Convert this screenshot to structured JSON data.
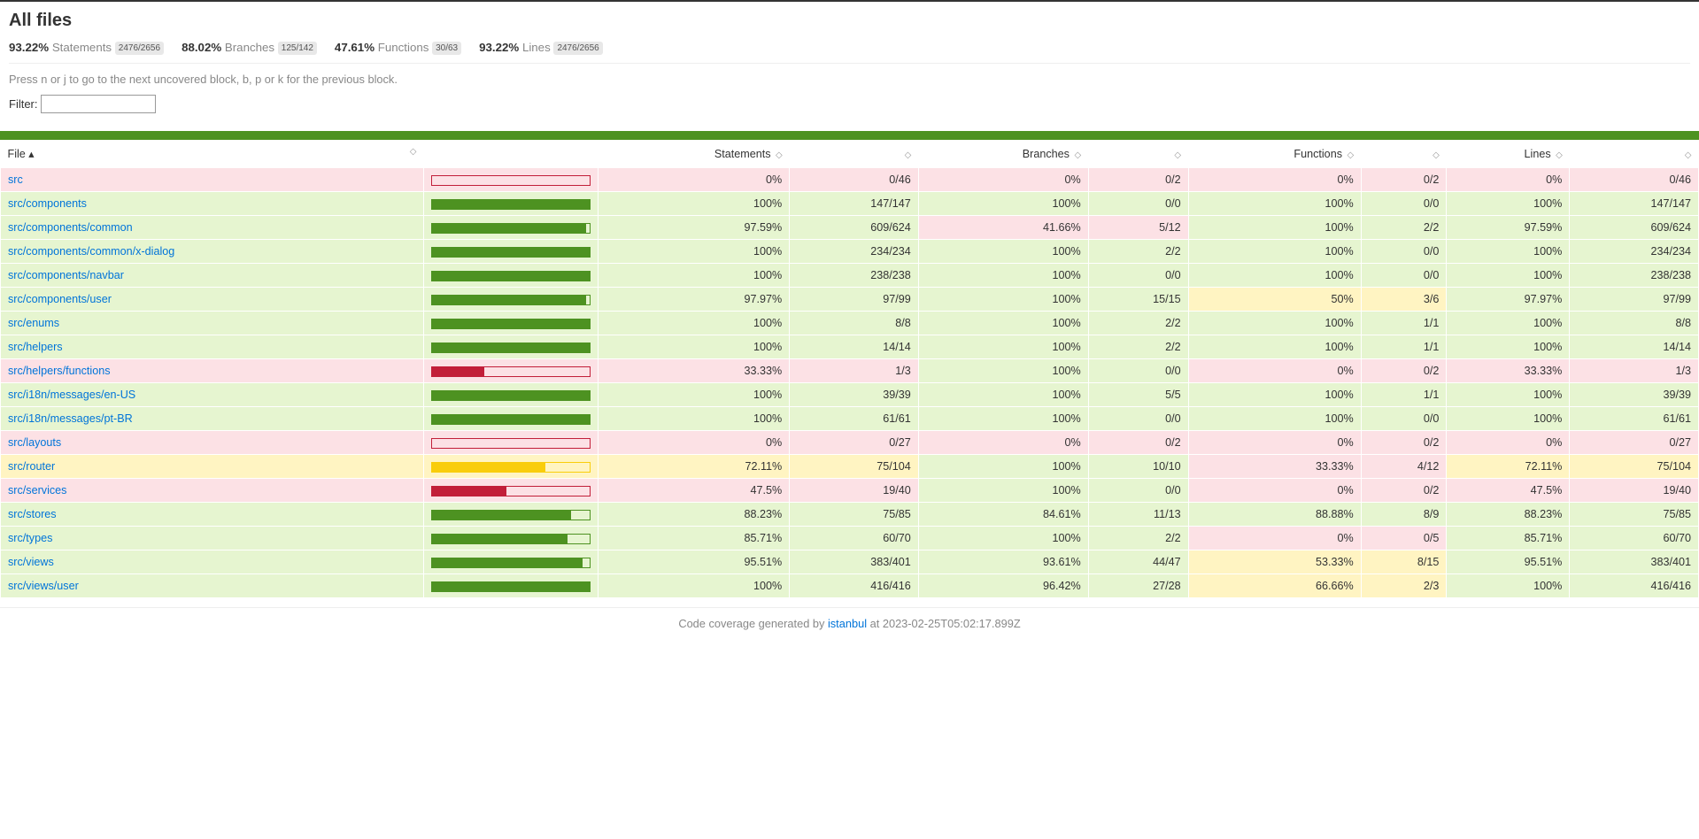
{
  "header": {
    "title": "All files",
    "summary": [
      {
        "pct": "93.22%",
        "label": "Statements",
        "fraction": "2476/2656"
      },
      {
        "pct": "88.02%",
        "label": "Branches",
        "fraction": "125/142"
      },
      {
        "pct": "47.61%",
        "label": "Functions",
        "fraction": "30/63"
      },
      {
        "pct": "93.22%",
        "label": "Lines",
        "fraction": "2476/2656"
      }
    ],
    "help": "Press n or j to go to the next uncovered block, b, p or k for the previous block.",
    "filter_label": "Filter: "
  },
  "columns": [
    "File",
    "",
    "Statements",
    "",
    "Branches",
    "",
    "Functions",
    "",
    "Lines",
    ""
  ],
  "rows": [
    {
      "file": "src",
      "bar": 0,
      "level": "low",
      "stmt_pct": "0%",
      "stmt_abs": "0/46",
      "br_pct": "0%",
      "br_abs": "0/2",
      "br_level": "low",
      "fn_pct": "0%",
      "fn_abs": "0/2",
      "fn_level": "low",
      "ln_pct": "0%",
      "ln_abs": "0/46"
    },
    {
      "file": "src/components",
      "bar": 100,
      "level": "high",
      "stmt_pct": "100%",
      "stmt_abs": "147/147",
      "br_pct": "100%",
      "br_abs": "0/0",
      "br_level": "high",
      "fn_pct": "100%",
      "fn_abs": "0/0",
      "fn_level": "high",
      "ln_pct": "100%",
      "ln_abs": "147/147"
    },
    {
      "file": "src/components/common",
      "bar": 97.59,
      "level": "high",
      "stmt_pct": "97.59%",
      "stmt_abs": "609/624",
      "br_pct": "41.66%",
      "br_abs": "5/12",
      "br_level": "low",
      "fn_pct": "100%",
      "fn_abs": "2/2",
      "fn_level": "high",
      "ln_pct": "97.59%",
      "ln_abs": "609/624"
    },
    {
      "file": "src/components/common/x-dialog",
      "bar": 100,
      "level": "high",
      "stmt_pct": "100%",
      "stmt_abs": "234/234",
      "br_pct": "100%",
      "br_abs": "2/2",
      "br_level": "high",
      "fn_pct": "100%",
      "fn_abs": "0/0",
      "fn_level": "high",
      "ln_pct": "100%",
      "ln_abs": "234/234"
    },
    {
      "file": "src/components/navbar",
      "bar": 100,
      "level": "high",
      "stmt_pct": "100%",
      "stmt_abs": "238/238",
      "br_pct": "100%",
      "br_abs": "0/0",
      "br_level": "high",
      "fn_pct": "100%",
      "fn_abs": "0/0",
      "fn_level": "high",
      "ln_pct": "100%",
      "ln_abs": "238/238"
    },
    {
      "file": "src/components/user",
      "bar": 97.97,
      "level": "high",
      "stmt_pct": "97.97%",
      "stmt_abs": "97/99",
      "br_pct": "100%",
      "br_abs": "15/15",
      "br_level": "high",
      "fn_pct": "50%",
      "fn_abs": "3/6",
      "fn_level": "medium",
      "ln_pct": "97.97%",
      "ln_abs": "97/99"
    },
    {
      "file": "src/enums",
      "bar": 100,
      "level": "high",
      "stmt_pct": "100%",
      "stmt_abs": "8/8",
      "br_pct": "100%",
      "br_abs": "2/2",
      "br_level": "high",
      "fn_pct": "100%",
      "fn_abs": "1/1",
      "fn_level": "high",
      "ln_pct": "100%",
      "ln_abs": "8/8"
    },
    {
      "file": "src/helpers",
      "bar": 100,
      "level": "high",
      "stmt_pct": "100%",
      "stmt_abs": "14/14",
      "br_pct": "100%",
      "br_abs": "2/2",
      "br_level": "high",
      "fn_pct": "100%",
      "fn_abs": "1/1",
      "fn_level": "high",
      "ln_pct": "100%",
      "ln_abs": "14/14"
    },
    {
      "file": "src/helpers/functions",
      "bar": 33.33,
      "level": "low",
      "stmt_pct": "33.33%",
      "stmt_abs": "1/3",
      "br_pct": "100%",
      "br_abs": "0/0",
      "br_level": "high",
      "fn_pct": "0%",
      "fn_abs": "0/2",
      "fn_level": "low",
      "ln_pct": "33.33%",
      "ln_abs": "1/3"
    },
    {
      "file": "src/i18n/messages/en-US",
      "bar": 100,
      "level": "high",
      "stmt_pct": "100%",
      "stmt_abs": "39/39",
      "br_pct": "100%",
      "br_abs": "5/5",
      "br_level": "high",
      "fn_pct": "100%",
      "fn_abs": "1/1",
      "fn_level": "high",
      "ln_pct": "100%",
      "ln_abs": "39/39"
    },
    {
      "file": "src/i18n/messages/pt-BR",
      "bar": 100,
      "level": "high",
      "stmt_pct": "100%",
      "stmt_abs": "61/61",
      "br_pct": "100%",
      "br_abs": "0/0",
      "br_level": "high",
      "fn_pct": "100%",
      "fn_abs": "0/0",
      "fn_level": "high",
      "ln_pct": "100%",
      "ln_abs": "61/61"
    },
    {
      "file": "src/layouts",
      "bar": 0,
      "level": "low",
      "stmt_pct": "0%",
      "stmt_abs": "0/27",
      "br_pct": "0%",
      "br_abs": "0/2",
      "br_level": "low",
      "fn_pct": "0%",
      "fn_abs": "0/2",
      "fn_level": "low",
      "ln_pct": "0%",
      "ln_abs": "0/27"
    },
    {
      "file": "src/router",
      "bar": 72.11,
      "level": "medium",
      "stmt_pct": "72.11%",
      "stmt_abs": "75/104",
      "br_pct": "100%",
      "br_abs": "10/10",
      "br_level": "high",
      "fn_pct": "33.33%",
      "fn_abs": "4/12",
      "fn_level": "low",
      "ln_pct": "72.11%",
      "ln_abs": "75/104"
    },
    {
      "file": "src/services",
      "bar": 47.5,
      "level": "low",
      "stmt_pct": "47.5%",
      "stmt_abs": "19/40",
      "br_pct": "100%",
      "br_abs": "0/0",
      "br_level": "high",
      "fn_pct": "0%",
      "fn_abs": "0/2",
      "fn_level": "low",
      "ln_pct": "47.5%",
      "ln_abs": "19/40"
    },
    {
      "file": "src/stores",
      "bar": 88.23,
      "level": "high",
      "stmt_pct": "88.23%",
      "stmt_abs": "75/85",
      "br_pct": "84.61%",
      "br_abs": "11/13",
      "br_level": "high",
      "fn_pct": "88.88%",
      "fn_abs": "8/9",
      "fn_level": "high",
      "ln_pct": "88.23%",
      "ln_abs": "75/85"
    },
    {
      "file": "src/types",
      "bar": 85.71,
      "level": "high",
      "stmt_pct": "85.71%",
      "stmt_abs": "60/70",
      "br_pct": "100%",
      "br_abs": "2/2",
      "br_level": "high",
      "fn_pct": "0%",
      "fn_abs": "0/5",
      "fn_level": "low",
      "ln_pct": "85.71%",
      "ln_abs": "60/70"
    },
    {
      "file": "src/views",
      "bar": 95.51,
      "level": "high",
      "stmt_pct": "95.51%",
      "stmt_abs": "383/401",
      "br_pct": "93.61%",
      "br_abs": "44/47",
      "br_level": "high",
      "fn_pct": "53.33%",
      "fn_abs": "8/15",
      "fn_level": "medium",
      "ln_pct": "95.51%",
      "ln_abs": "383/401"
    },
    {
      "file": "src/views/user",
      "bar": 100,
      "level": "high",
      "stmt_pct": "100%",
      "stmt_abs": "416/416",
      "br_pct": "96.42%",
      "br_abs": "27/28",
      "br_level": "high",
      "fn_pct": "66.66%",
      "fn_abs": "2/3",
      "fn_level": "medium",
      "ln_pct": "100%",
      "ln_abs": "416/416"
    }
  ],
  "footer": {
    "text_prefix": "Code coverage generated by ",
    "link": "istanbul",
    "text_suffix": " at 2023-02-25T05:02:17.899Z"
  }
}
